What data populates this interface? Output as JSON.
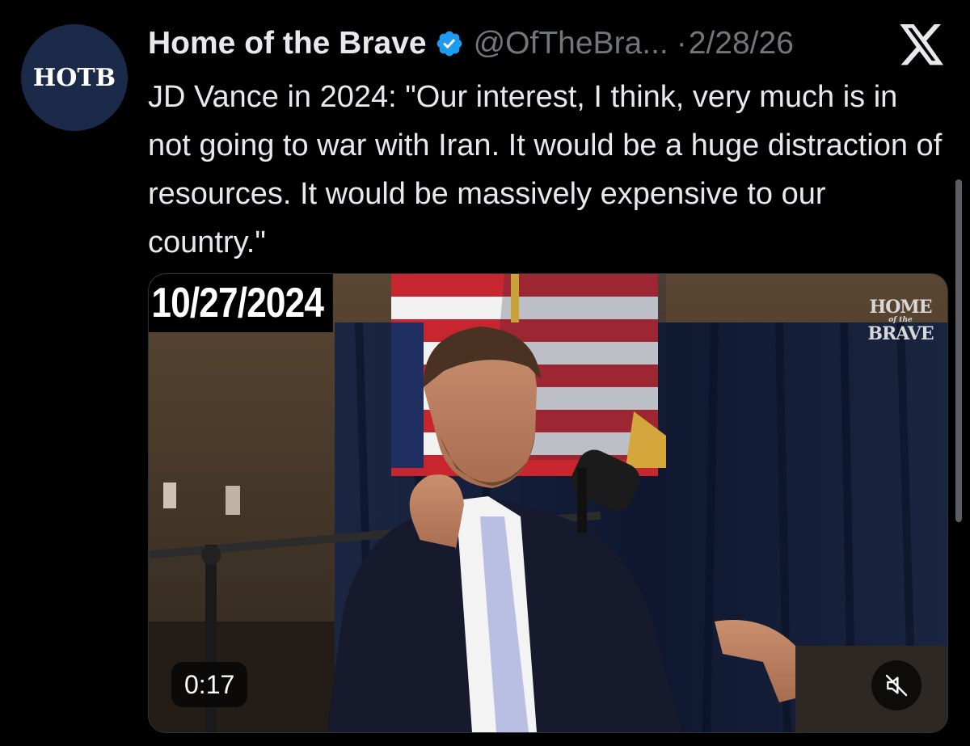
{
  "account": {
    "avatar_text": "HOTB",
    "display_name": "Home of the Brave",
    "verified": true,
    "handle": "@OfTheBra...",
    "separator": "·",
    "date": "2/28/26"
  },
  "platform_icon": "x-logo-icon",
  "tweet": {
    "text": "JD Vance in 2024: \"Our interest, I think, very much is in not going to war with Iran. It would be a huge distraction of resources. It would be massively expensive to our country.\""
  },
  "video": {
    "date_stamp": "10/27/2024",
    "watermark_top": "HOME",
    "watermark_mid": "of the",
    "watermark_bottom": "BRAVE",
    "timestamp": "0:17",
    "mute_icon": "speaker-muted-icon"
  },
  "colors": {
    "background": "#000000",
    "text": "#e7e9ea",
    "muted_text": "#71767b",
    "verified_blue": "#1d9bf0"
  }
}
